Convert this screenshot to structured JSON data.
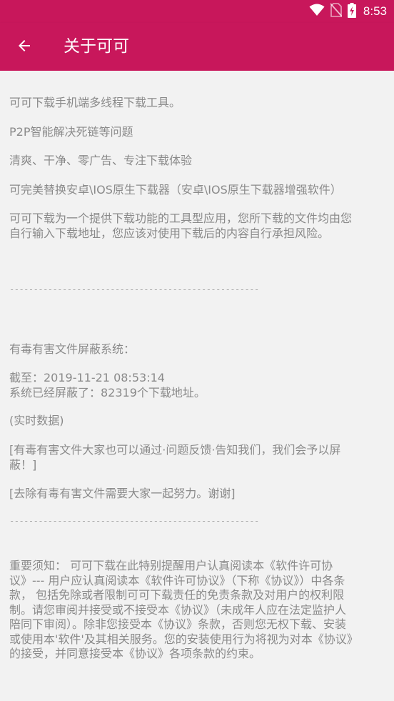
{
  "status_bar": {
    "time": "8:53",
    "icons": [
      "wifi-icon",
      "no-sim-icon",
      "battery-charging-icon"
    ]
  },
  "app_bar": {
    "back_icon": "arrow-left-icon",
    "title": "关于可可"
  },
  "content": {
    "intro": "可可下载手机端多线程下载工具。",
    "line2": "P2P智能解决死链等问题",
    "line3": "清爽、干净、零广告、专注下载体验",
    "line4": "可完美替换安卓\\IOS原生下载器（安卓\\IOS原生下载器增强软件）",
    "disclaimer": "可可下载为一个提供下载功能的工具型应用，您所下载的文件均由您\n自行输入下载地址，您应该对使用下载后的内容自行承担风险。",
    "divider1": "----------------------------------------------------",
    "blocker_title": "有毒有害文件屏蔽系统：",
    "blocker_stats": "截至：2019-11-21 08:53:14\n系统已经屏蔽了：82319个下载地址。",
    "realtime": "(实时数据)",
    "report": "[有毒有害文件大家也可以通过·问题反馈·告知我们，我们会予以屏\n蔽！]",
    "effort": "[去除有毒有害文件需要大家一起努力。谢谢]",
    "divider2": "----------------------------------------------------",
    "notice": "重要须知： 可可下载在此特别提醒用户认真阅读本《软件许可协\n议》--- 用户应认真阅读本《软件许可协议》（下称《协议》）中各条\n款， 包括免除或者限制可可下载责任的免责条款及对用户的权利限\n制。请您审阅并接受或不接受本《协议》（未成年人应在法定监护人\n陪同下审阅）。除非您接受本《协议》条款，否则您无权下载、安装\n或使用本'软件'及其相关服务。您的安装使用行为将视为对本《协议》\n的接受，并同意接受本《协议》各项条款的约束。"
  },
  "colors": {
    "primary": "#c8175b",
    "text": "#8a8a8a",
    "background": "#f2f2f2"
  }
}
